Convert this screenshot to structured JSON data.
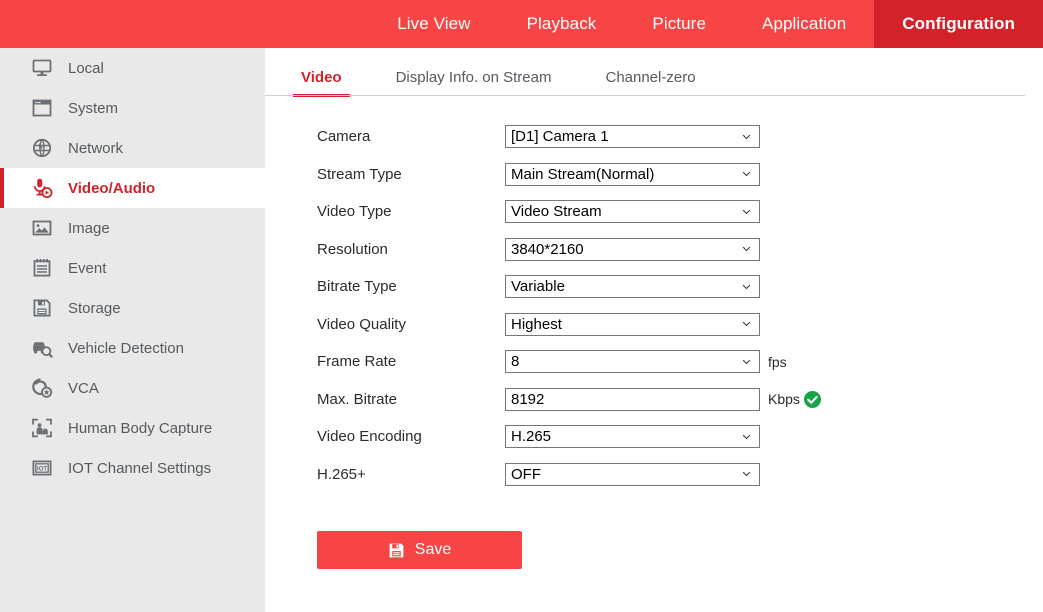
{
  "topnav": {
    "tabs": [
      {
        "label": "Live View",
        "active": false
      },
      {
        "label": "Playback",
        "active": false
      },
      {
        "label": "Picture",
        "active": false
      },
      {
        "label": "Application",
        "active": false
      },
      {
        "label": "Configuration",
        "active": true
      }
    ],
    "bg_color": "#f74545",
    "active_bg_color": "#d2232a"
  },
  "sidebar": {
    "bg_color": "#e9e9e9",
    "accent_color": "#d2232a",
    "items": [
      {
        "label": "Local",
        "icon": "monitor-icon",
        "active": false
      },
      {
        "label": "System",
        "icon": "window-icon",
        "active": false
      },
      {
        "label": "Network",
        "icon": "globe-icon",
        "active": false
      },
      {
        "label": "Video/Audio",
        "icon": "microphone-video-icon",
        "active": true
      },
      {
        "label": "Image",
        "icon": "picture-icon",
        "active": false
      },
      {
        "label": "Event",
        "icon": "notepad-icon",
        "active": false
      },
      {
        "label": "Storage",
        "icon": "floppy-disk-icon",
        "active": false
      },
      {
        "label": "Vehicle Detection",
        "icon": "vehicle-search-icon",
        "active": false
      },
      {
        "label": "VCA",
        "icon": "vca-icon",
        "active": false
      },
      {
        "label": "Human Body Capture",
        "icon": "human-capture-icon",
        "active": false
      },
      {
        "label": "IOT Channel Settings",
        "icon": "iot-icon",
        "active": false
      }
    ]
  },
  "main": {
    "subtabs": [
      {
        "label": "Video",
        "active": true
      },
      {
        "label": "Display Info. on Stream",
        "active": false
      },
      {
        "label": "Channel-zero",
        "active": false
      }
    ],
    "form": {
      "fields": [
        {
          "label": "Camera",
          "value": "[D1] Camera 1",
          "type": "select",
          "unit": "",
          "status": ""
        },
        {
          "label": "Stream Type",
          "value": "Main Stream(Normal)",
          "type": "select",
          "unit": "",
          "status": ""
        },
        {
          "label": "Video Type",
          "value": "Video Stream",
          "type": "select",
          "unit": "",
          "status": ""
        },
        {
          "label": "Resolution",
          "value": "3840*2160",
          "type": "select",
          "unit": "",
          "status": ""
        },
        {
          "label": "Bitrate Type",
          "value": "Variable",
          "type": "select",
          "unit": "",
          "status": ""
        },
        {
          "label": "Video Quality",
          "value": "Highest",
          "type": "select",
          "unit": "",
          "status": ""
        },
        {
          "label": "Frame Rate",
          "value": "8",
          "type": "select",
          "unit": "fps",
          "status": ""
        },
        {
          "label": "Max. Bitrate",
          "value": "8192",
          "type": "text",
          "unit": "Kbps",
          "status": "valid"
        },
        {
          "label": "Video Encoding",
          "value": "H.265",
          "type": "select",
          "unit": "",
          "status": ""
        },
        {
          "label": "H.265+",
          "value": "OFF",
          "type": "select",
          "unit": "",
          "status": ""
        }
      ]
    },
    "save_button": {
      "label": "Save",
      "icon": "save-floppy-icon",
      "color": "#f74545"
    },
    "status_valid_color": "#19a348"
  }
}
